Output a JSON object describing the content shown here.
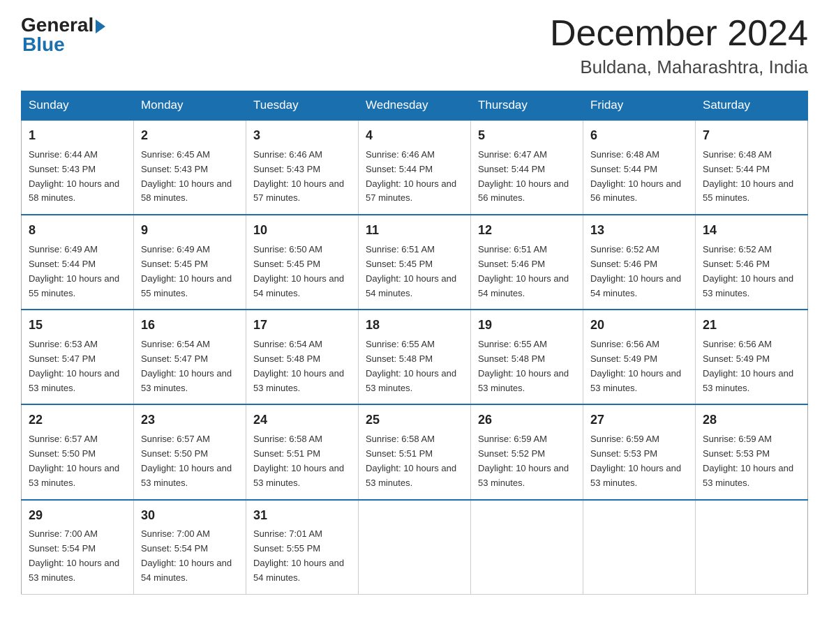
{
  "header": {
    "logo_general": "General",
    "logo_blue": "Blue",
    "month_title": "December 2024",
    "location": "Buldana, Maharashtra, India"
  },
  "days_of_week": [
    "Sunday",
    "Monday",
    "Tuesday",
    "Wednesday",
    "Thursday",
    "Friday",
    "Saturday"
  ],
  "weeks": [
    [
      {
        "day": "1",
        "sunrise": "6:44 AM",
        "sunset": "5:43 PM",
        "daylight": "10 hours and 58 minutes."
      },
      {
        "day": "2",
        "sunrise": "6:45 AM",
        "sunset": "5:43 PM",
        "daylight": "10 hours and 58 minutes."
      },
      {
        "day": "3",
        "sunrise": "6:46 AM",
        "sunset": "5:43 PM",
        "daylight": "10 hours and 57 minutes."
      },
      {
        "day": "4",
        "sunrise": "6:46 AM",
        "sunset": "5:44 PM",
        "daylight": "10 hours and 57 minutes."
      },
      {
        "day": "5",
        "sunrise": "6:47 AM",
        "sunset": "5:44 PM",
        "daylight": "10 hours and 56 minutes."
      },
      {
        "day": "6",
        "sunrise": "6:48 AM",
        "sunset": "5:44 PM",
        "daylight": "10 hours and 56 minutes."
      },
      {
        "day": "7",
        "sunrise": "6:48 AM",
        "sunset": "5:44 PM",
        "daylight": "10 hours and 55 minutes."
      }
    ],
    [
      {
        "day": "8",
        "sunrise": "6:49 AM",
        "sunset": "5:44 PM",
        "daylight": "10 hours and 55 minutes."
      },
      {
        "day": "9",
        "sunrise": "6:49 AM",
        "sunset": "5:45 PM",
        "daylight": "10 hours and 55 minutes."
      },
      {
        "day": "10",
        "sunrise": "6:50 AM",
        "sunset": "5:45 PM",
        "daylight": "10 hours and 54 minutes."
      },
      {
        "day": "11",
        "sunrise": "6:51 AM",
        "sunset": "5:45 PM",
        "daylight": "10 hours and 54 minutes."
      },
      {
        "day": "12",
        "sunrise": "6:51 AM",
        "sunset": "5:46 PM",
        "daylight": "10 hours and 54 minutes."
      },
      {
        "day": "13",
        "sunrise": "6:52 AM",
        "sunset": "5:46 PM",
        "daylight": "10 hours and 54 minutes."
      },
      {
        "day": "14",
        "sunrise": "6:52 AM",
        "sunset": "5:46 PM",
        "daylight": "10 hours and 53 minutes."
      }
    ],
    [
      {
        "day": "15",
        "sunrise": "6:53 AM",
        "sunset": "5:47 PM",
        "daylight": "10 hours and 53 minutes."
      },
      {
        "day": "16",
        "sunrise": "6:54 AM",
        "sunset": "5:47 PM",
        "daylight": "10 hours and 53 minutes."
      },
      {
        "day": "17",
        "sunrise": "6:54 AM",
        "sunset": "5:48 PM",
        "daylight": "10 hours and 53 minutes."
      },
      {
        "day": "18",
        "sunrise": "6:55 AM",
        "sunset": "5:48 PM",
        "daylight": "10 hours and 53 minutes."
      },
      {
        "day": "19",
        "sunrise": "6:55 AM",
        "sunset": "5:48 PM",
        "daylight": "10 hours and 53 minutes."
      },
      {
        "day": "20",
        "sunrise": "6:56 AM",
        "sunset": "5:49 PM",
        "daylight": "10 hours and 53 minutes."
      },
      {
        "day": "21",
        "sunrise": "6:56 AM",
        "sunset": "5:49 PM",
        "daylight": "10 hours and 53 minutes."
      }
    ],
    [
      {
        "day": "22",
        "sunrise": "6:57 AM",
        "sunset": "5:50 PM",
        "daylight": "10 hours and 53 minutes."
      },
      {
        "day": "23",
        "sunrise": "6:57 AM",
        "sunset": "5:50 PM",
        "daylight": "10 hours and 53 minutes."
      },
      {
        "day": "24",
        "sunrise": "6:58 AM",
        "sunset": "5:51 PM",
        "daylight": "10 hours and 53 minutes."
      },
      {
        "day": "25",
        "sunrise": "6:58 AM",
        "sunset": "5:51 PM",
        "daylight": "10 hours and 53 minutes."
      },
      {
        "day": "26",
        "sunrise": "6:59 AM",
        "sunset": "5:52 PM",
        "daylight": "10 hours and 53 minutes."
      },
      {
        "day": "27",
        "sunrise": "6:59 AM",
        "sunset": "5:53 PM",
        "daylight": "10 hours and 53 minutes."
      },
      {
        "day": "28",
        "sunrise": "6:59 AM",
        "sunset": "5:53 PM",
        "daylight": "10 hours and 53 minutes."
      }
    ],
    [
      {
        "day": "29",
        "sunrise": "7:00 AM",
        "sunset": "5:54 PM",
        "daylight": "10 hours and 53 minutes."
      },
      {
        "day": "30",
        "sunrise": "7:00 AM",
        "sunset": "5:54 PM",
        "daylight": "10 hours and 54 minutes."
      },
      {
        "day": "31",
        "sunrise": "7:01 AM",
        "sunset": "5:55 PM",
        "daylight": "10 hours and 54 minutes."
      },
      null,
      null,
      null,
      null
    ]
  ]
}
